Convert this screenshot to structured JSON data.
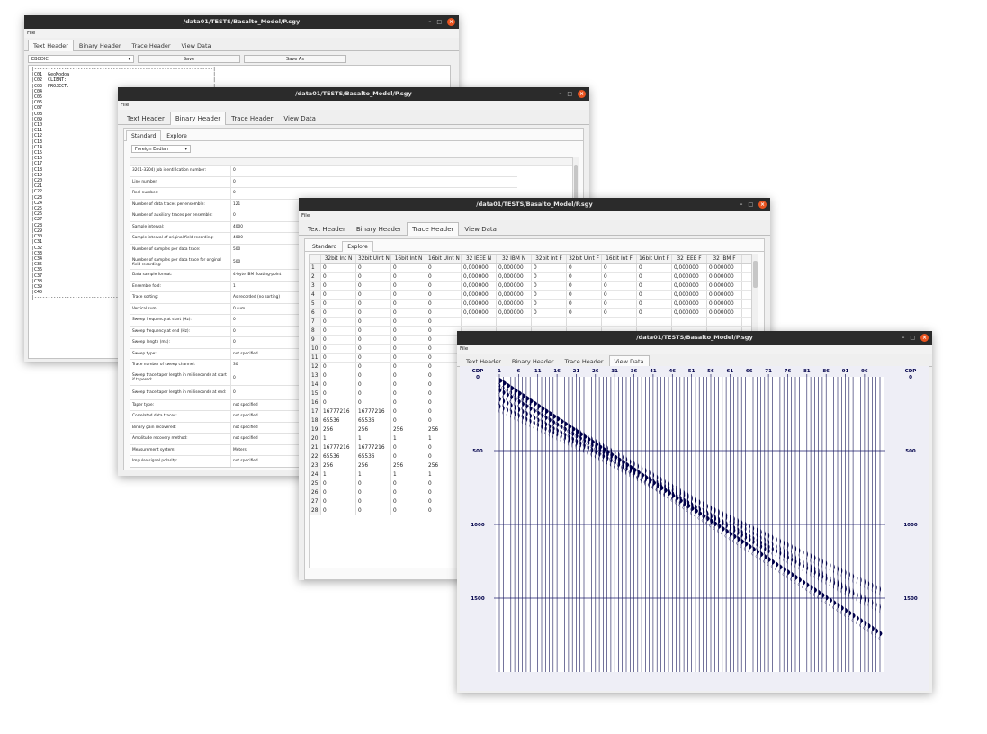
{
  "colors": {
    "titlebar": "#2b2b2b",
    "close": "#e95420",
    "seismic": "#00004a",
    "grid": "#1c1c6b"
  },
  "window_title": "/data01/TESTS/Basalto_Model/P.sgy",
  "menu": {
    "file": "File"
  },
  "tabs": {
    "text": "Text Header",
    "binary": "Binary Header",
    "trace": "Trace Header",
    "view": "View Data"
  },
  "controls": {
    "minimize": "–",
    "maximize": "□",
    "close": "×"
  },
  "text_header": {
    "encoding": "EBCDIC",
    "save": "Save",
    "save_as": "Save As",
    "lines": [
      "|------------------------------------------------------------------|",
      "|C01  GeoModoa                                                     |",
      "|C02  CLIENT:                                                      |",
      "|C03  PROJECT:                                                     |",
      "|C04",
      "|C05",
      "|C06",
      "|C07",
      "|C08",
      "|C09",
      "|C10",
      "|C11",
      "|C12",
      "|C13",
      "|C14",
      "|C15",
      "|C16",
      "|C17",
      "|C18",
      "|C19",
      "|C20",
      "|C21",
      "|C22",
      "|C23",
      "|C24",
      "|C25",
      "|C26",
      "|C27",
      "|C28",
      "|C29",
      "|C30",
      "|C31",
      "|C32",
      "|C33",
      "|C34",
      "|C35",
      "|C36",
      "|C37",
      "|C38",
      "|C39",
      "|C40",
      "|------------------------------------------------------------------"
    ]
  },
  "binary_header": {
    "subtabs": {
      "standard": "Standard",
      "explore": "Explore"
    },
    "endian": "Foreign Endian",
    "rows": [
      {
        "k": "3201-3204) Job identification number:",
        "v": "0"
      },
      {
        "k": "Line number:",
        "v": "0"
      },
      {
        "k": "Reel number:",
        "v": "0"
      },
      {
        "k": "Number of data traces per ensemble:",
        "v": "121"
      },
      {
        "k": "Number of auxiliary traces per ensemble:",
        "v": "0"
      },
      {
        "k": "Sample interval:",
        "v": "4000"
      },
      {
        "k": "Sample interval of original field recording:",
        "v": "4000"
      },
      {
        "k": "Number of samples per data trace:",
        "v": "500"
      },
      {
        "k": "Number of samples per data trace for original field recording:",
        "v": "500"
      },
      {
        "k": "Data sample format:",
        "v": "4-byte IBM floating-point"
      },
      {
        "k": "Ensemble fold:",
        "v": "1"
      },
      {
        "k": "Trace sorting:",
        "v": "As recorded (no sorting)"
      },
      {
        "k": "Vertical sum:",
        "v": "0 sum"
      },
      {
        "k": "Sweep frequency at start (Hz):",
        "v": "0"
      },
      {
        "k": "Sweep frequency at end (Hz):",
        "v": "0"
      },
      {
        "k": "Sweep length (ms):",
        "v": "0"
      },
      {
        "k": "Sweep type:",
        "v": "not specified"
      },
      {
        "k": "Trace number of sweep channel:",
        "v": "30"
      },
      {
        "k": "Sweep trace taper length in milliseconds at start if tapered:",
        "v": "0"
      },
      {
        "k": "Sweep trace taper length in milliseconds at end:",
        "v": "0"
      },
      {
        "k": "Taper type:",
        "v": "not specified"
      },
      {
        "k": "Correlated data traces:",
        "v": "not specified"
      },
      {
        "k": "Binary gain recovered:",
        "v": "not specified"
      },
      {
        "k": "Amplitude recovery method:",
        "v": "not specified"
      },
      {
        "k": "Measurement system:",
        "v": "Meters"
      },
      {
        "k": "Impulse signal polarity:",
        "v": "not specified"
      }
    ]
  },
  "trace_header": {
    "subtabs": {
      "standard": "Standard",
      "explore": "Explore"
    },
    "columns": [
      "32bit Int N",
      "32bit UInt N",
      "16bit Int N",
      "16bit UInt N",
      "32 IEEE N",
      "32 IBM N",
      "32bit Int F",
      "32bit UInt F",
      "16bit Int F",
      "16bit UInt F",
      "32 IEEE F",
      "32 IBM F"
    ],
    "rows": [
      [
        "1",
        "0",
        "0",
        "0",
        "0",
        "0,000000",
        "0,000000",
        "0",
        "0",
        "0",
        "0",
        "0,000000",
        "0,000000"
      ],
      [
        "2",
        "0",
        "0",
        "0",
        "0",
        "0,000000",
        "0,000000",
        "0",
        "0",
        "0",
        "0",
        "0,000000",
        "0,000000"
      ],
      [
        "3",
        "0",
        "0",
        "0",
        "0",
        "0,000000",
        "0,000000",
        "0",
        "0",
        "0",
        "0",
        "0,000000",
        "0,000000"
      ],
      [
        "4",
        "0",
        "0",
        "0",
        "0",
        "0,000000",
        "0,000000",
        "0",
        "0",
        "0",
        "0",
        "0,000000",
        "0,000000"
      ],
      [
        "5",
        "0",
        "0",
        "0",
        "0",
        "0,000000",
        "0,000000",
        "0",
        "0",
        "0",
        "0",
        "0,000000",
        "0,000000"
      ],
      [
        "6",
        "0",
        "0",
        "0",
        "0",
        "0,000000",
        "0,000000",
        "0",
        "0",
        "0",
        "0",
        "0,000000",
        "0,000000"
      ],
      [
        "7",
        "0",
        "0",
        "0",
        "0",
        "",
        "",
        "",
        "",
        "",
        "",
        "",
        ""
      ],
      [
        "8",
        "0",
        "0",
        "0",
        "0",
        "",
        "",
        "",
        "",
        "",
        "",
        "",
        ""
      ],
      [
        "9",
        "0",
        "0",
        "0",
        "0",
        "",
        "",
        "",
        "",
        "",
        "",
        "",
        ""
      ],
      [
        "10",
        "0",
        "0",
        "0",
        "0",
        "",
        "",
        "",
        "",
        "",
        "",
        "",
        ""
      ],
      [
        "11",
        "0",
        "0",
        "0",
        "0",
        "",
        "",
        "",
        "",
        "",
        "",
        "",
        ""
      ],
      [
        "12",
        "0",
        "0",
        "0",
        "0",
        "",
        "",
        "",
        "",
        "",
        "",
        "",
        ""
      ],
      [
        "13",
        "0",
        "0",
        "0",
        "0",
        "",
        "",
        "",
        "",
        "",
        "",
        "",
        ""
      ],
      [
        "14",
        "0",
        "0",
        "0",
        "0",
        "",
        "",
        "",
        "",
        "",
        "",
        "",
        ""
      ],
      [
        "15",
        "0",
        "0",
        "0",
        "0",
        "",
        "",
        "",
        "",
        "",
        "",
        "",
        ""
      ],
      [
        "16",
        "0",
        "0",
        "0",
        "0",
        "",
        "",
        "",
        "",
        "",
        "",
        "",
        ""
      ],
      [
        "17",
        "16777216",
        "16777216",
        "0",
        "0",
        "",
        "",
        "",
        "",
        "",
        "",
        "",
        ""
      ],
      [
        "18",
        "65536",
        "65536",
        "0",
        "0",
        "",
        "",
        "",
        "",
        "",
        "",
        "",
        ""
      ],
      [
        "19",
        "256",
        "256",
        "256",
        "256",
        "",
        "",
        "",
        "",
        "",
        "",
        "",
        ""
      ],
      [
        "20",
        "1",
        "1",
        "1",
        "1",
        "",
        "",
        "",
        "",
        "",
        "",
        "",
        ""
      ],
      [
        "21",
        "16777216",
        "16777216",
        "0",
        "0",
        "",
        "",
        "",
        "",
        "",
        "",
        "",
        ""
      ],
      [
        "22",
        "65536",
        "65536",
        "0",
        "0",
        "",
        "",
        "",
        "",
        "",
        "",
        "",
        ""
      ],
      [
        "23",
        "256",
        "256",
        "256",
        "256",
        "",
        "",
        "",
        "",
        "",
        "",
        "",
        ""
      ],
      [
        "24",
        "1",
        "1",
        "1",
        "1",
        "",
        "",
        "",
        "",
        "",
        "",
        "",
        ""
      ],
      [
        "25",
        "0",
        "0",
        "0",
        "0",
        "",
        "",
        "",
        "",
        "",
        "",
        "",
        ""
      ],
      [
        "26",
        "0",
        "0",
        "0",
        "0",
        "",
        "",
        "",
        "",
        "",
        "",
        "",
        ""
      ],
      [
        "27",
        "0",
        "0",
        "0",
        "0",
        "",
        "",
        "",
        "",
        "",
        "",
        "",
        ""
      ],
      [
        "28",
        "0",
        "0",
        "0",
        "0",
        "",
        "",
        "",
        "",
        "",
        "",
        "",
        ""
      ]
    ]
  },
  "view_data": {
    "cdp_label": "CDP",
    "cdp_ticks": [
      "1",
      "6",
      "11",
      "16",
      "21",
      "26",
      "31",
      "36",
      "41",
      "46",
      "51",
      "56",
      "61",
      "66",
      "71",
      "76",
      "81",
      "86",
      "91",
      "96"
    ],
    "time_ticks": [
      0,
      500,
      1000,
      1500
    ],
    "time_max": 2000,
    "trace_count": 100
  }
}
